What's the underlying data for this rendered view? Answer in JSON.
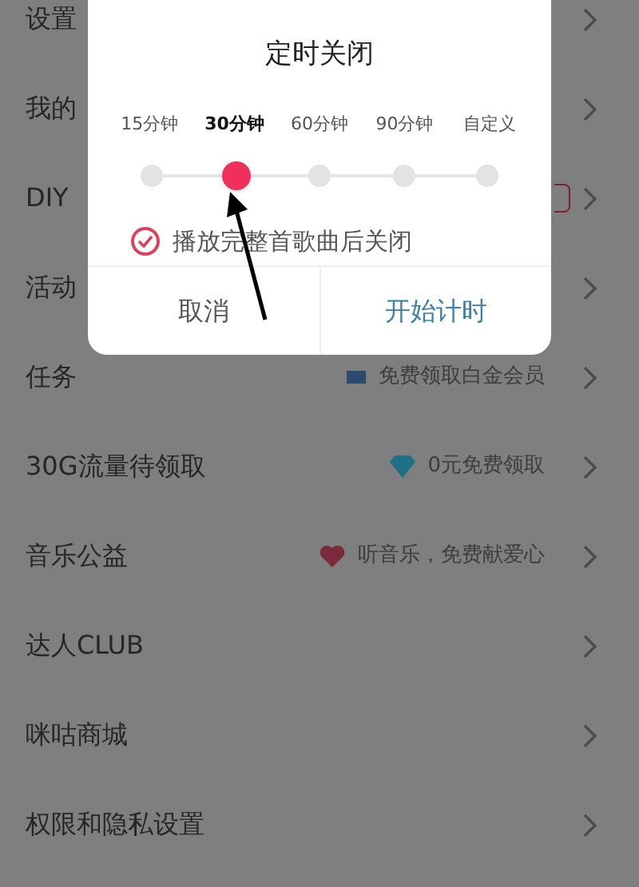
{
  "menu": [
    {
      "label": "设置"
    },
    {
      "label": "我的"
    },
    {
      "label": "DIY",
      "kind": "tag"
    },
    {
      "label": "活动"
    },
    {
      "label": "任务",
      "kind": "flag",
      "hint": "免费领取白金会员"
    },
    {
      "label": "30G流量待领取",
      "kind": "diamond",
      "hint": "0元免费领取"
    },
    {
      "label": "音乐公益",
      "kind": "heart",
      "hint": "听音乐，免费献爱心"
    },
    {
      "label": "达人CLUB"
    },
    {
      "label": "咪咕商城"
    },
    {
      "label": "权限和隐私设置"
    }
  ],
  "dialog": {
    "title": "定时关闭",
    "options": [
      {
        "label": "15分钟",
        "selected": false
      },
      {
        "label": "30分钟",
        "selected": true
      },
      {
        "label": "60分钟",
        "selected": false
      },
      {
        "label": "90分钟",
        "selected": false
      },
      {
        "label": "自定义",
        "selected": false
      }
    ],
    "checkbox": {
      "label": "播放完整首歌曲后关闭",
      "checked": true
    },
    "buttons": [
      {
        "label": "取消",
        "kind": "cancel"
      },
      {
        "label": "开始计时",
        "kind": "confirm"
      }
    ]
  }
}
